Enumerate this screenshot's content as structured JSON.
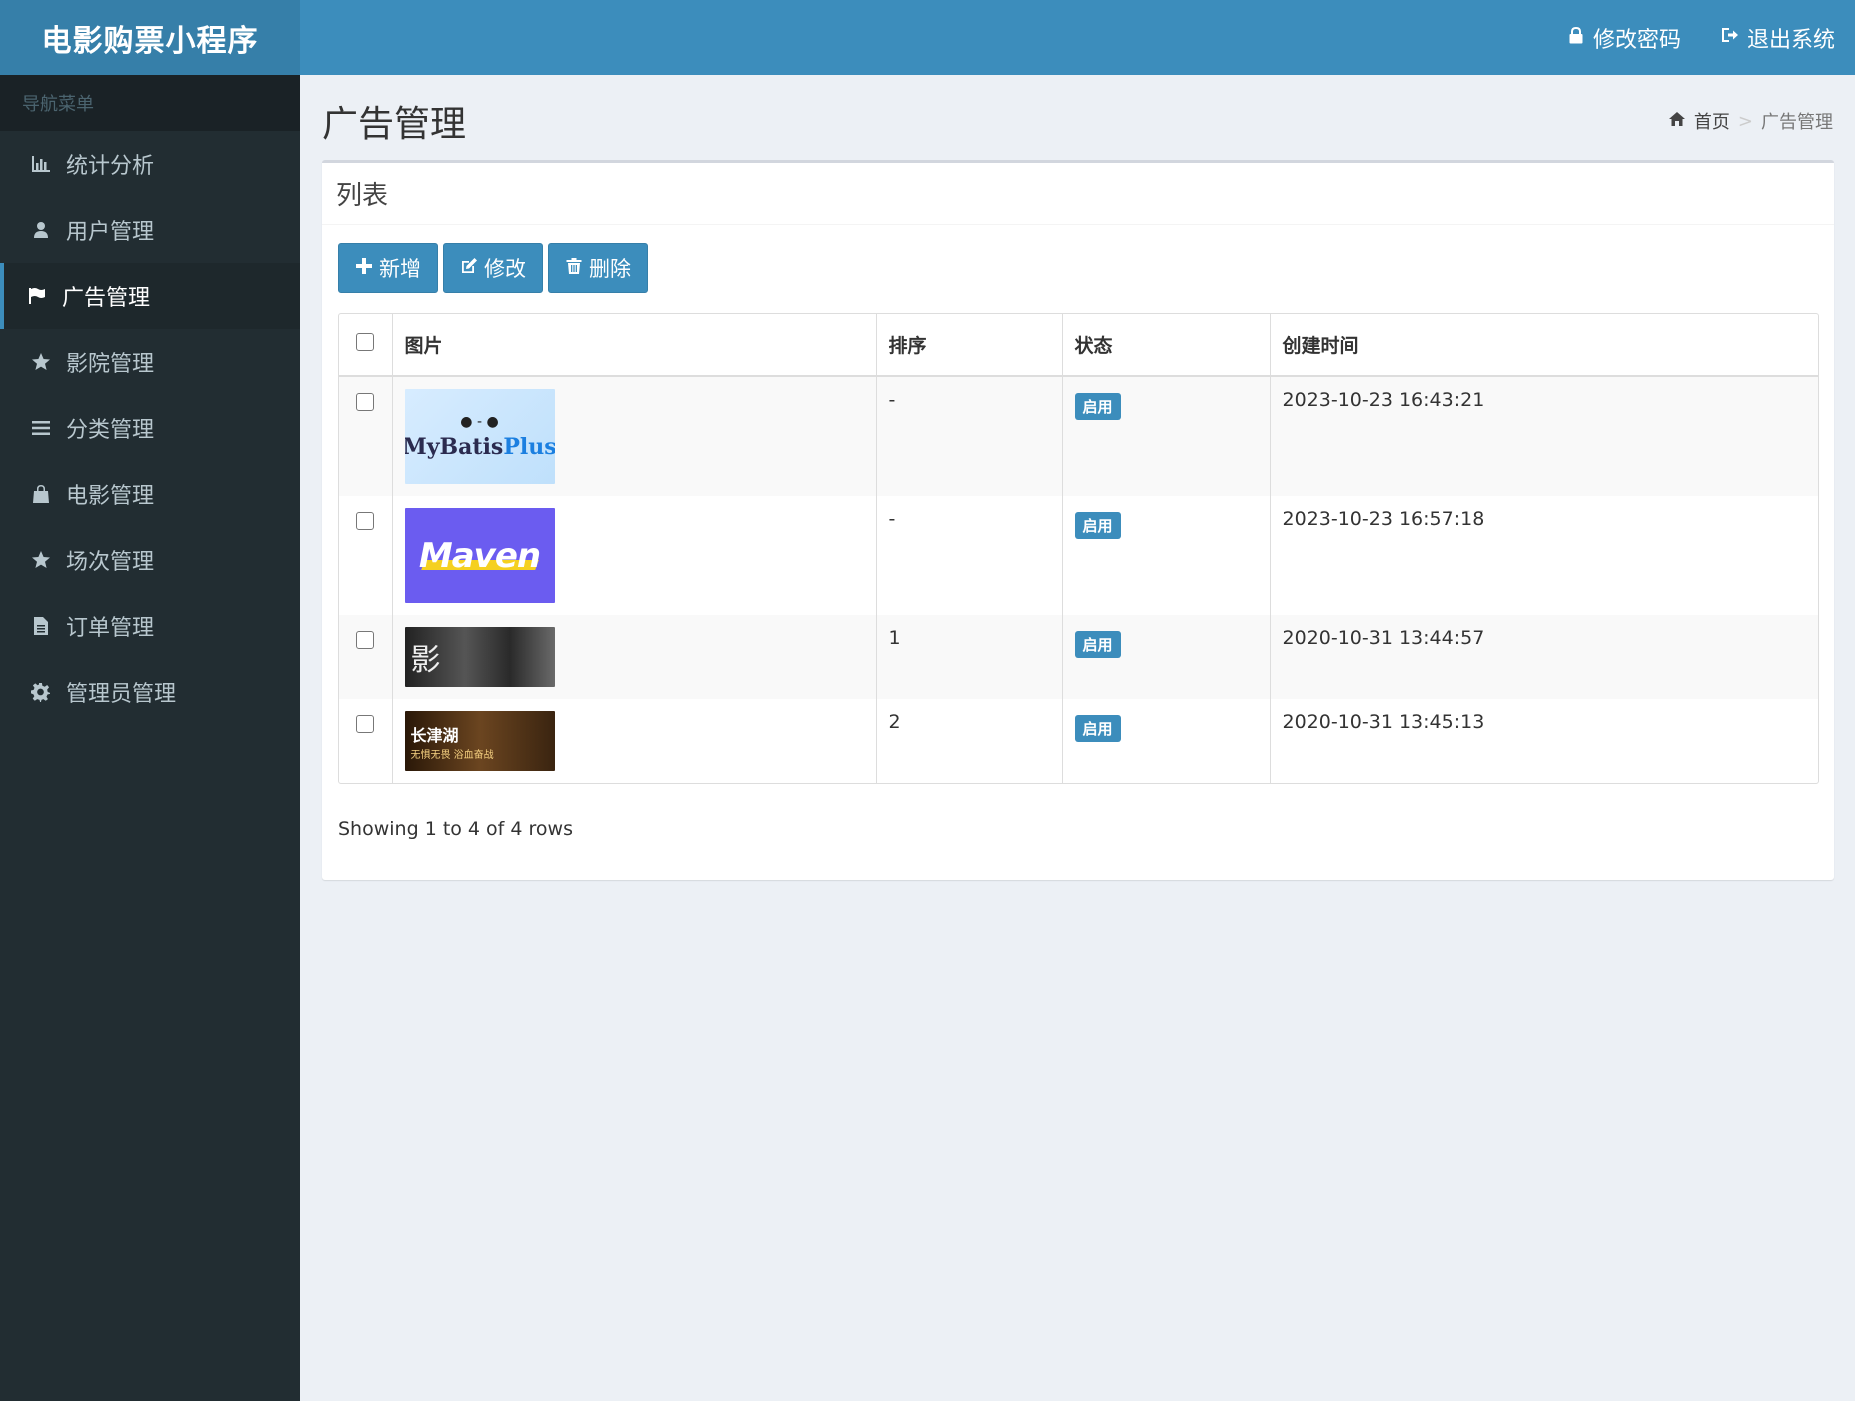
{
  "app": {
    "title": "电影购票小程序"
  },
  "sidebar": {
    "header": "导航菜单",
    "items": [
      {
        "label": "统计分析",
        "icon": "bar-chart-icon"
      },
      {
        "label": "用户管理",
        "icon": "user-icon"
      },
      {
        "label": "广告管理",
        "icon": "flag-icon",
        "active": true
      },
      {
        "label": "影院管理",
        "icon": "star-icon"
      },
      {
        "label": "分类管理",
        "icon": "list-icon"
      },
      {
        "label": "电影管理",
        "icon": "shopping-bag-icon"
      },
      {
        "label": "场次管理",
        "icon": "star-icon"
      },
      {
        "label": "订单管理",
        "icon": "file-icon"
      },
      {
        "label": "管理员管理",
        "icon": "gear-icon"
      }
    ]
  },
  "topbar": {
    "change_password": "修改密码",
    "logout": "退出系统"
  },
  "page": {
    "title": "广告管理"
  },
  "breadcrumb": {
    "home": "首页",
    "separator": ">",
    "current": "广告管理"
  },
  "box": {
    "title": "列表"
  },
  "toolbar": {
    "add": "新增",
    "edit": "修改",
    "delete": "删除"
  },
  "table": {
    "headers": {
      "image": "图片",
      "sort": "排序",
      "status": "状态",
      "created": "创建时间"
    },
    "rows": [
      {
        "image_text_1": "MyBatis",
        "image_text_2": "Plus",
        "sort": "-",
        "status": "启用",
        "created": "2023-10-23 16:43:21"
      },
      {
        "image_text_1": "Maven",
        "sort": "-",
        "status": "启用",
        "created": "2023-10-23 16:57:18"
      },
      {
        "image_text_1": "影",
        "sort": "1",
        "status": "启用",
        "created": "2020-10-31 13:44:57"
      },
      {
        "image_text_1": "长津湖",
        "image_text_2": "无惧无畏 浴血奋战",
        "sort": "2",
        "status": "启用",
        "created": "2020-10-31 13:45:13"
      }
    ]
  },
  "pagination": {
    "summary": "Showing 1 to 4 of 4 rows"
  },
  "colors": {
    "primary": "#3c8dbc",
    "sidebar_bg": "#222d32",
    "logo_bg": "#367fa9",
    "content_bg": "#ecf0f5"
  }
}
